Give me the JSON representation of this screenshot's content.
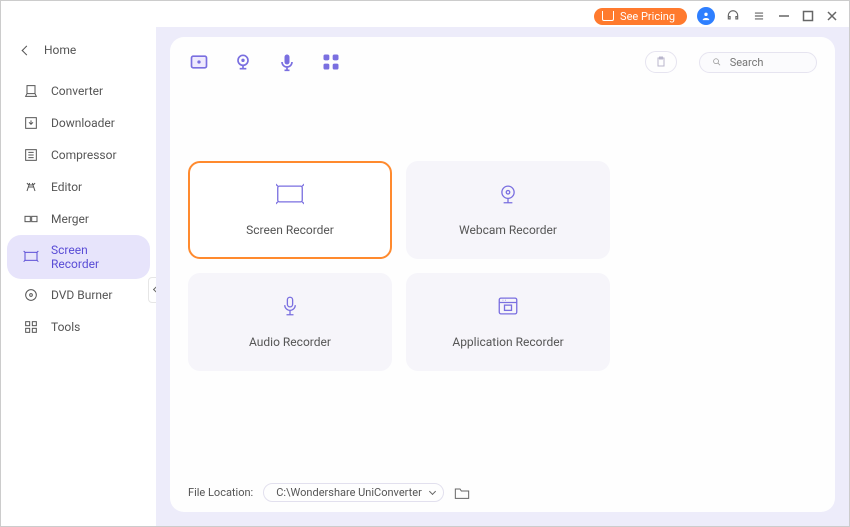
{
  "titlebar": {
    "pricing_label": "See Pricing"
  },
  "colors": {
    "accent": "#7a6fe0",
    "highlight_border": "#ff8a2e",
    "pricing_bg": "#ff7a2e",
    "user_badge": "#2e7fff"
  },
  "sidebar": {
    "home_label": "Home",
    "items": [
      {
        "label": "Converter",
        "icon": "converter-icon"
      },
      {
        "label": "Downloader",
        "icon": "downloader-icon"
      },
      {
        "label": "Compressor",
        "icon": "compressor-icon"
      },
      {
        "label": "Editor",
        "icon": "editor-icon"
      },
      {
        "label": "Merger",
        "icon": "merger-icon"
      },
      {
        "label": "Screen Recorder",
        "icon": "screen-recorder-icon",
        "active": true
      },
      {
        "label": "DVD Burner",
        "icon": "dvd-burner-icon"
      },
      {
        "label": "Tools",
        "icon": "tools-icon"
      }
    ]
  },
  "toolbar": {
    "icons": [
      "screen-tool-icon",
      "webcam-tool-icon",
      "audio-tool-icon",
      "app-tool-icon"
    ]
  },
  "search": {
    "placeholder": "Search"
  },
  "cards": [
    {
      "label": "Screen Recorder",
      "icon": "screen-card-icon",
      "active": true
    },
    {
      "label": "Webcam Recorder",
      "icon": "webcam-card-icon"
    },
    {
      "label": "Audio Recorder",
      "icon": "audio-card-icon"
    },
    {
      "label": "Application Recorder",
      "icon": "app-card-icon"
    }
  ],
  "footer": {
    "label": "File Location:",
    "path": "C:\\Wondershare UniConverter"
  }
}
